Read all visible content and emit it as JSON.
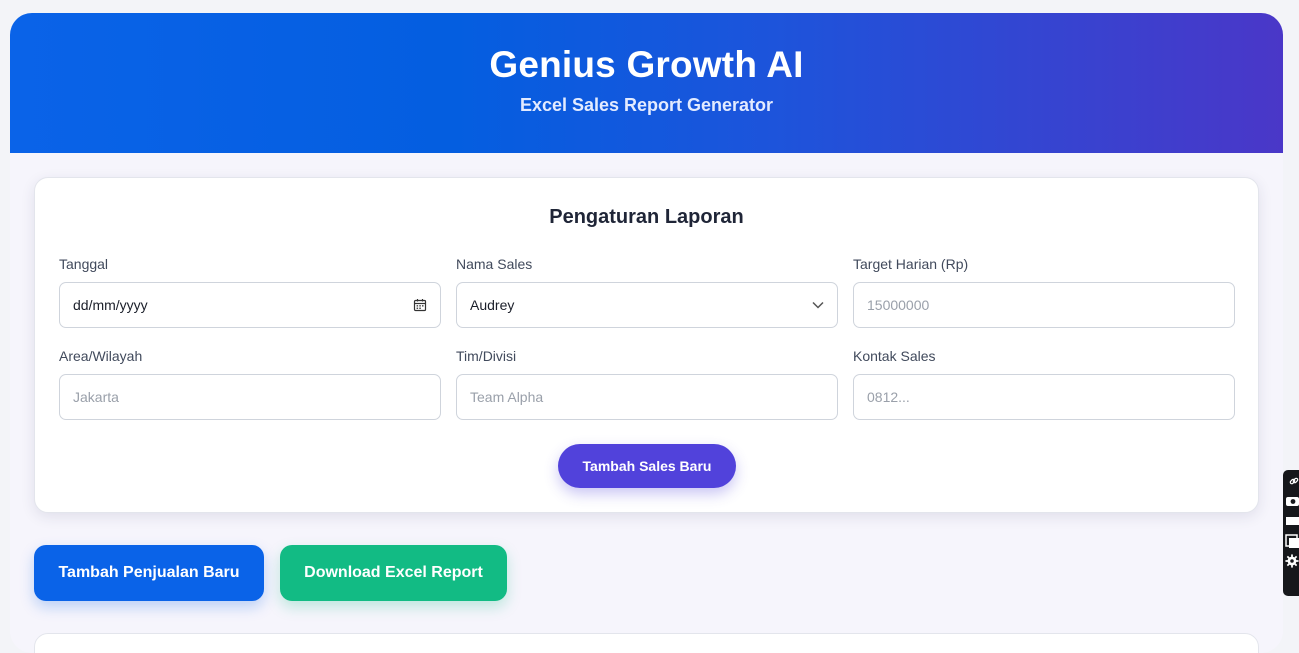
{
  "header": {
    "title": "Genius Growth AI",
    "subtitle": "Excel Sales Report Generator"
  },
  "settings": {
    "title": "Pengaturan Laporan",
    "fields": {
      "date": {
        "label": "Tanggal",
        "value": "dd/mm/yyyy",
        "icon": "calendar-icon"
      },
      "sales_name": {
        "label": "Nama Sales",
        "value": "Audrey",
        "icon": "chevron-down-icon"
      },
      "daily_target": {
        "label": "Target Harian (Rp)",
        "placeholder": "15000000"
      },
      "area": {
        "label": "Area/Wilayah",
        "placeholder": "Jakarta"
      },
      "team": {
        "label": "Tim/Divisi",
        "placeholder": "Team Alpha"
      },
      "contact": {
        "label": "Kontak Sales",
        "placeholder": "0812..."
      }
    },
    "add_sales_button": "Tambah Sales Baru"
  },
  "actions": {
    "add_sale": "Tambah Penjualan Baru",
    "download_excel": "Download Excel Report"
  },
  "colors": {
    "header_gradient_start": "#0a63e8",
    "header_gradient_end": "#4a37c8",
    "primary": "#0a63e8",
    "purple": "#5142db",
    "green": "#12bb84"
  },
  "side_toolbar": {
    "icons": [
      "link-icon",
      "camera-icon",
      "rectangle-icon",
      "window-icon",
      "gear-icon"
    ]
  }
}
